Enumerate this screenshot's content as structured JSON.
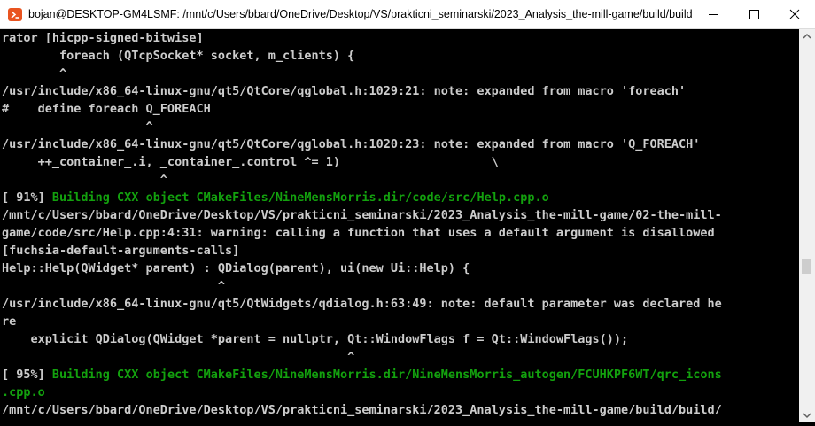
{
  "window": {
    "title": "bojan@DESKTOP-GM4LSMF: /mnt/c/Users/bbard/OneDrive/Desktop/VS/prakticni_seminarski/2023_Analysis_the-mill-game/build/build",
    "app_icon": "ubuntu-terminal-icon",
    "controls": [
      "minimize-icon",
      "maximize-icon",
      "close-icon"
    ]
  },
  "colors": {
    "background": "#000000",
    "text": "#cccccc",
    "progress_green": "#13a10e",
    "titlebar": "#ffffff"
  },
  "terminal": {
    "lines": [
      {
        "text": "rator [hicpp-signed-bitwise]"
      },
      {
        "text": "        foreach (QTcpSocket* socket, m_clients) {"
      },
      {
        "text": "        ^"
      },
      {
        "text": "/usr/include/x86_64-linux-gnu/qt5/QtCore/qglobal.h:1029:21: note: expanded from macro 'foreach'"
      },
      {
        "text": "#    define foreach Q_FOREACH"
      },
      {
        "text": "                    ^"
      },
      {
        "text": "/usr/include/x86_64-linux-gnu/qt5/QtCore/qglobal.h:1020:23: note: expanded from macro 'Q_FOREACH'"
      },
      {
        "text": "     ++_container_.i, _container_.control ^= 1)                     \\"
      },
      {
        "text": "                      ^"
      },
      {
        "prefix": "[ 91%] ",
        "green": "Building CXX object CMakeFiles/NineMensMorris.dir/code/src/Help.cpp.o"
      },
      {
        "text": "/mnt/c/Users/bbard/OneDrive/Desktop/VS/prakticni_seminarski/2023_Analysis_the-mill-game/02-the-mill-"
      },
      {
        "text": "game/code/src/Help.cpp:4:31: warning: calling a function that uses a default argument is disallowed"
      },
      {
        "text": "[fuchsia-default-arguments-calls]"
      },
      {
        "text": "Help::Help(QWidget* parent) : QDialog(parent), ui(new Ui::Help) {"
      },
      {
        "text": "                              ^"
      },
      {
        "text": "/usr/include/x86_64-linux-gnu/qt5/QtWidgets/qdialog.h:63:49: note: default parameter was declared he"
      },
      {
        "text": "re"
      },
      {
        "text": "    explicit QDialog(QWidget *parent = nullptr, Qt::WindowFlags f = Qt::WindowFlags());"
      },
      {
        "text": "                                                ^"
      },
      {
        "prefix": "[ 95%] ",
        "green": "Building CXX object CMakeFiles/NineMensMorris.dir/NineMensMorris_autogen/FCUHKPF6WT/qrc_icons"
      },
      {
        "green": ".cpp.o"
      },
      {
        "text": "/mnt/c/Users/bbard/OneDrive/Desktop/VS/prakticni_seminarski/2023_Analysis_the-mill-game/build/build/"
      }
    ]
  },
  "scrollbar": {
    "up_icon": "scroll-up-arrow-icon",
    "down_icon": "scroll-down-arrow-icon"
  }
}
